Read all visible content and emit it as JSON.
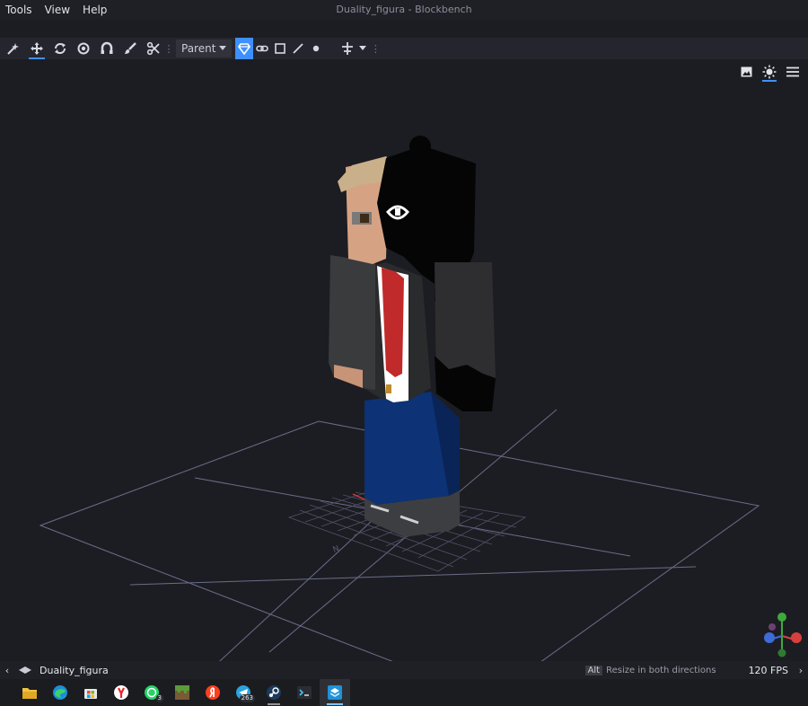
{
  "menu": [
    "Tools",
    "View",
    "Help"
  ],
  "window_title": "Duality_figura - Blockbench",
  "toolbar": {
    "pivot_select": "Parent",
    "tools": [
      "move-tool",
      "rotate-tool",
      "pivot-tool",
      "vertex-snap-tool",
      "paint-brush-tool",
      "cut-tool"
    ],
    "selection_modes": [
      "object",
      "link",
      "face",
      "edge",
      "vertex"
    ]
  },
  "viewport": {
    "controls": [
      "image-icon",
      "lighting-icon",
      "menu-icon"
    ]
  },
  "statusbar": {
    "project_name": "Duality_figura",
    "key_hint": "Alt",
    "hint_text": "Resize in both directions",
    "fps": "120 FPS"
  },
  "taskbar": {
    "apps": [
      "File Explorer",
      "Microsoft Edge",
      "Microsoft Store",
      "Yandex Browser",
      "WhatsApp",
      "Minecraft",
      "Yandex",
      "Telegram",
      "Steam",
      "Terminal",
      "Blockbench"
    ],
    "whatsapp_badge": "3",
    "telegram_badge": "263"
  },
  "colors": {
    "accent": "#3e90ff",
    "background": "#1c1d22"
  }
}
